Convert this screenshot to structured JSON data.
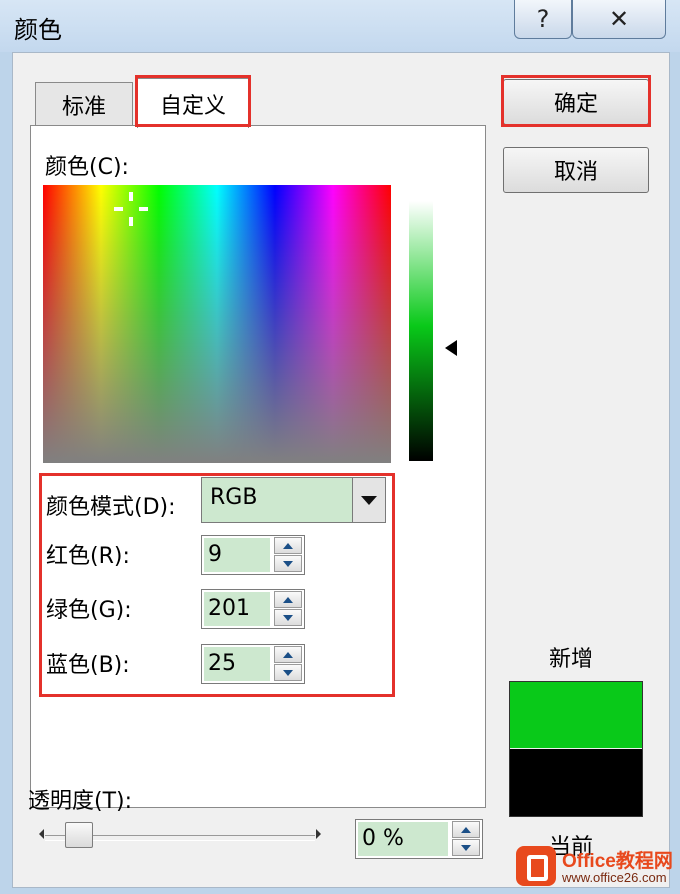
{
  "window": {
    "title": "颜色",
    "help_glyph": "?",
    "close_glyph": "✕"
  },
  "tabs": [
    {
      "label": "标准"
    },
    {
      "label": "自定义"
    }
  ],
  "colors_label": "颜色(C):",
  "color_model": {
    "label": "颜色模式(D):",
    "value": "RGB"
  },
  "red": {
    "label": "红色(R):",
    "value": "9"
  },
  "green": {
    "label": "绿色(G):",
    "value": "201"
  },
  "blue": {
    "label": "蓝色(B):",
    "value": "25"
  },
  "buttons": {
    "ok": "确定",
    "cancel": "取消"
  },
  "transparency": {
    "label": "透明度(T):",
    "value": "0 %",
    "level": 0
  },
  "preview": {
    "new_label": "新增",
    "current_label": "当前",
    "new_color": "#09c919",
    "current_color": "#000000"
  },
  "watermark": {
    "title": "Office教程网",
    "url": "www.office26.com"
  },
  "accent_red": "#e4312b"
}
